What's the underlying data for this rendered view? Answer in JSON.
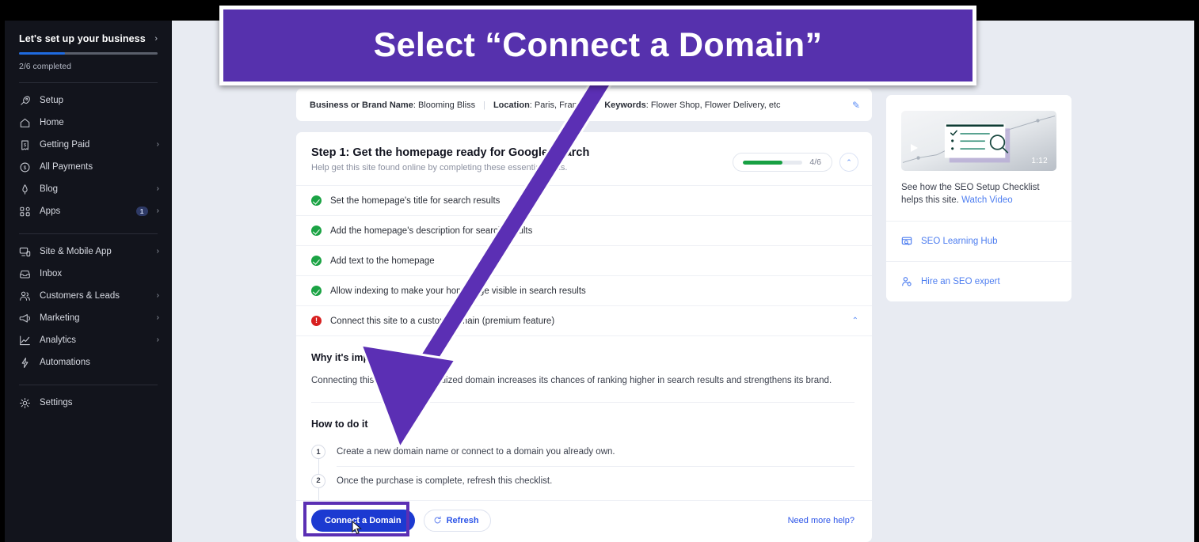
{
  "annotation": {
    "banner_text": "Select “Connect a Domain”",
    "banner_color": "#5631ad",
    "arrow_color": "#5b2fb4",
    "highlight_color": "#5b2fb4"
  },
  "sidebar": {
    "header": {
      "title": "Let's set up your business",
      "chevron": "›",
      "progress_label": "2/6 completed",
      "progress_percent": 33,
      "progress_color": "#1f6be0"
    },
    "items": [
      {
        "label": "Setup",
        "icon": "rocket-icon",
        "chevron": "",
        "badge": ""
      },
      {
        "label": "Home",
        "icon": "home-icon",
        "chevron": "",
        "badge": ""
      },
      {
        "label": "Getting Paid",
        "icon": "receipt-icon",
        "chevron": "›",
        "badge": ""
      },
      {
        "label": "All Payments",
        "icon": "dollar-circle-icon",
        "chevron": "",
        "badge": ""
      },
      {
        "label": "Blog",
        "icon": "pen-icon",
        "chevron": "›",
        "badge": ""
      },
      {
        "label": "Apps",
        "icon": "apps-icon",
        "chevron": "›",
        "badge": "1"
      }
    ],
    "items2": [
      {
        "label": "Site & Mobile App",
        "icon": "monitor-icon",
        "chevron": "›",
        "badge": ""
      },
      {
        "label": "Inbox",
        "icon": "inbox-icon",
        "chevron": "",
        "badge": ""
      },
      {
        "label": "Customers & Leads",
        "icon": "people-icon",
        "chevron": "›",
        "badge": ""
      },
      {
        "label": "Marketing",
        "icon": "megaphone-icon",
        "chevron": "›",
        "badge": ""
      },
      {
        "label": "Analytics",
        "icon": "chart-icon",
        "chevron": "›",
        "badge": ""
      },
      {
        "label": "Automations",
        "icon": "bolt-icon",
        "chevron": "",
        "badge": ""
      }
    ],
    "items3": [
      {
        "label": "Settings",
        "icon": "gear-icon",
        "chevron": "",
        "badge": ""
      }
    ]
  },
  "business_bar": {
    "name_label": "Business or Brand Name",
    "name_value": ": Blooming Bliss",
    "location_label": "Location",
    "location_value": ": Paris, France",
    "keywords_label": "Keywords",
    "keywords_value": ": Flower Shop, Flower Delivery, etc",
    "edit_icon": "✎"
  },
  "step_card": {
    "title": "Step 1: Get the homepage ready for Google Search",
    "subtitle": "Help get this site found online by completing these essential tasks.",
    "progress_label": "4/6",
    "progress_percent": 66,
    "progress_color": "#17a043",
    "collapse_icon": "⌃",
    "checklist": [
      {
        "label": "Set the homepage's title for search results",
        "state": "done"
      },
      {
        "label": "Add the homepage's description for search results",
        "state": "done"
      },
      {
        "label": "Add text to the homepage",
        "state": "done"
      },
      {
        "label": "Allow indexing to make your homepage visible in search results",
        "state": "done"
      },
      {
        "label": "Connect this site to a custom domain (premium feature)",
        "state": "error"
      }
    ]
  },
  "detail": {
    "why_heading": "Why it's important",
    "why_body": "Connecting this site to a personalized domain increases its chances of ranking higher in search results and strengthens its brand.",
    "how_heading": "How to do it",
    "how_steps": [
      {
        "num": "1",
        "text": "Create a new domain name or connect to a domain you already own."
      },
      {
        "num": "2",
        "text": "Once the purchase is complete, refresh this checklist."
      }
    ],
    "primary_button": "Connect a Domain",
    "refresh_button": "Refresh",
    "help_link": "Need more help?"
  },
  "rail": {
    "video_duration": "1:12",
    "caption_text": "See how the SEO Setup Checklist helps this site. ",
    "caption_link": "Watch Video",
    "links": [
      {
        "label": "SEO Learning Hub",
        "icon": "learning-hub-icon"
      },
      {
        "label": "Hire an SEO expert",
        "icon": "expert-icon"
      }
    ]
  }
}
